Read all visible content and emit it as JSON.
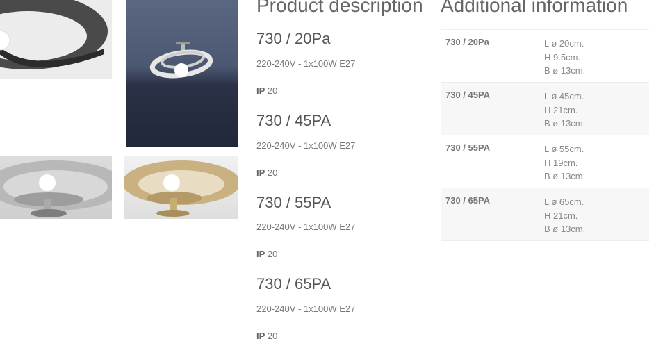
{
  "product_description": {
    "heading": "Product description",
    "models": [
      {
        "name": "730 / 20Pa",
        "voltage": "220-240V - 1x100W E27",
        "ip_label": "IP",
        "ip_value": "20"
      },
      {
        "name": "730 / 45PA",
        "voltage": "220-240V - 1x100W E27",
        "ip_label": "IP",
        "ip_value": "20"
      },
      {
        "name": "730 / 55PA",
        "voltage": "220-240V - 1x100W E27",
        "ip_label": "IP",
        "ip_value": "20"
      },
      {
        "name": "730 / 65PA",
        "voltage": "220-240V - 1x100W E27",
        "ip_label": "IP",
        "ip_value": "20"
      }
    ]
  },
  "additional_information": {
    "heading": "Additional information",
    "rows": [
      {
        "model": "730 / 20Pa",
        "l": "L ø 20cm.",
        "h": "H 9.5cm.",
        "b": "B ø 13cm."
      },
      {
        "model": "730 / 45PA",
        "l": "L ø 45cm.",
        "h": "H 21cm.",
        "b": "B ø 13cm."
      },
      {
        "model": "730 / 55PA",
        "l": "L ø 55cm.",
        "h": "H 19cm.",
        "b": "B ø 13cm."
      },
      {
        "model": "730 / 65PA",
        "l": "L ø 65cm.",
        "h": "H 21cm.",
        "b": "B ø 13cm."
      }
    ]
  }
}
